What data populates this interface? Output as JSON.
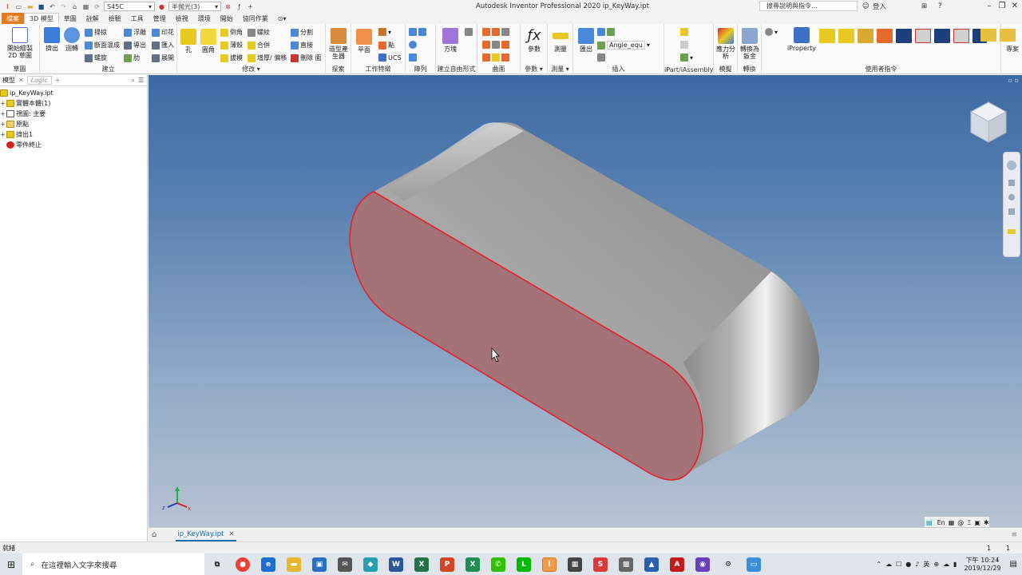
{
  "title_bar": {
    "material": "S45C",
    "appearance": "半抛光(3)",
    "window_title": "Autodesk Inventor Professional 2020   ip_KeyWay.ipt",
    "search_placeholder": "搜尋說明與指令...",
    "sign_in": "登入"
  },
  "tabs": [
    "檔案",
    "3D 模型",
    "草圖",
    "註解",
    "檢驗",
    "工具",
    "管理",
    "檢視",
    "環境",
    "開始",
    "協同作業"
  ],
  "ribbon": {
    "sketch": {
      "start_2d": "開始繪製 2D 草圖",
      "label": "草圖"
    },
    "create": {
      "extrude": "擠出",
      "revolve": "迴轉",
      "loft": "掃掠",
      "sweep": "斷面混成",
      "coil": "螺旋",
      "emboss": "浮雕",
      "derive": "導出",
      "rib": "肋",
      "decal": "印花",
      "import": "匯入",
      "unfold": "展開",
      "label": "建立"
    },
    "modify": {
      "hole": "孔",
      "fillet": "圓角",
      "chamfer": "倒角",
      "shell": "薄殼",
      "draft": "拔模",
      "thread": "螺紋",
      "combine": "合併",
      "thicken": "增厚/ 偏移",
      "split": "分割",
      "direct": "直接",
      "delete_face": "刪除 面",
      "label": "修改"
    },
    "explore": {
      "shape_gen": "造型產生器",
      "label": "探索"
    },
    "work_features": {
      "plane": "平面",
      "point": "點",
      "ucs": "UCS",
      "label": "工作特徵"
    },
    "pattern": {
      "label": "陣列"
    },
    "freeform": {
      "box": "方塊",
      "label": "建立自由形式"
    },
    "surface": {
      "label": "曲面"
    },
    "parameters": {
      "params": "參數",
      "label": "參數"
    },
    "measure": {
      "measure": "測量",
      "label": "測量"
    },
    "insert": {
      "export": "匯出",
      "dropdown": "Angle_equ",
      "label": "插入"
    },
    "ipart": {
      "label": "iPart/iAssembly"
    },
    "simulation": {
      "stress": "應力分析",
      "label": "模擬"
    },
    "convert": {
      "to_sheet": "轉換為鈑金",
      "label": "轉換"
    },
    "user_commands": {
      "iproperty": "iProperty",
      "label": "使用者指令"
    },
    "project": {
      "label": "專案"
    }
  },
  "browser": {
    "tab_model": "模型",
    "tab_logic": "Logic",
    "nodes": [
      "ip_KeyWay.ipt",
      "實體本體(1)",
      "視圖: 主要",
      "原點",
      "擠出1",
      "零件終止"
    ]
  },
  "document_tab": "ip_KeyWay.ipt",
  "status": {
    "text": "就緒",
    "count1": "1",
    "count2": "1"
  },
  "nav_bottom": {
    "lang": "En"
  },
  "taskbar": {
    "search_placeholder": "在這裡輸入文字來搜尋",
    "ime": "英",
    "time": "下午 10:24",
    "date": "2019/12/29"
  },
  "colors": {
    "file_tab": "#e37a1e",
    "accent_blue": "#1a6fb5",
    "selected_face": "#a47377",
    "edge_highlight": "#e8202a"
  }
}
